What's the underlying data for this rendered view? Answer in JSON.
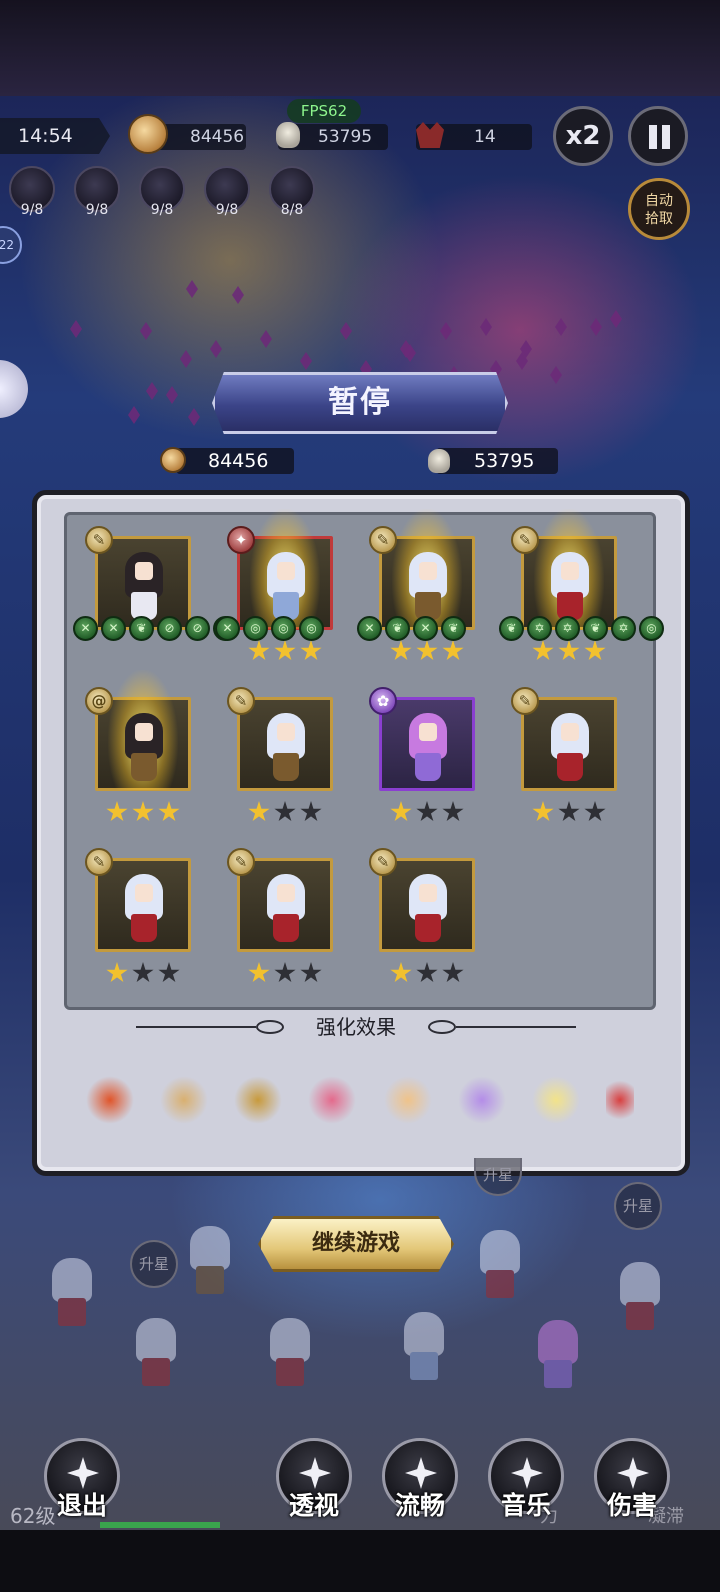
{
  "hud": {
    "fps": "FPS62",
    "timer": "14:54",
    "coins": "84456",
    "kills": "53795",
    "wave": "14",
    "speed_label": "x2",
    "pause_icon": "pause-icon",
    "auto_pickup_line1": "自动",
    "auto_pickup_line2": "拾取",
    "side_badge": "22",
    "skills": [
      {
        "icon": "key-icon",
        "level": "9/8"
      },
      {
        "icon": "sword-icon",
        "level": "9/8"
      },
      {
        "icon": "swirl-icon",
        "level": "9/8"
      },
      {
        "icon": "gear-star-icon",
        "level": "9/8"
      },
      {
        "icon": "claw-icon",
        "level": "8/8"
      }
    ]
  },
  "pause_panel": {
    "title": "暂停",
    "coins": "84456",
    "kills": "53795",
    "section_title": "强化效果",
    "continue_label": "继续游戏",
    "heroes": [
      {
        "element": "wind",
        "frame": "gold",
        "hair": "dark",
        "body": "white",
        "glow": false,
        "stars": 0,
        "gear": [
          "✕",
          "✕",
          "❦",
          "⊘",
          "⊘",
          "❦"
        ]
      },
      {
        "element": "fire",
        "frame": "red",
        "hair": "light",
        "body": "blue",
        "glow": true,
        "stars": 3,
        "gear": [
          "✕",
          "◎",
          "◎",
          "◎"
        ]
      },
      {
        "element": "wind",
        "frame": "gold",
        "hair": "light",
        "body": "gold",
        "glow": true,
        "stars": 3,
        "gear": [
          "✕",
          "❦",
          "✕",
          "❦"
        ]
      },
      {
        "element": "wind",
        "frame": "gold",
        "hair": "light",
        "body": "red",
        "glow": true,
        "stars": 3,
        "gear": [
          "❦",
          "✡",
          "✡",
          "❦",
          "✡",
          "◎"
        ]
      },
      {
        "element": "swirl",
        "frame": "gold",
        "hair": "dark",
        "body": "gold",
        "glow": true,
        "stars": 3,
        "gear": []
      },
      {
        "element": "wind",
        "frame": "gold",
        "hair": "light",
        "body": "gold",
        "glow": false,
        "stars": 1,
        "gear": []
      },
      {
        "element": "gear",
        "frame": "purple",
        "hair": "pink",
        "body": "violet",
        "glow": false,
        "stars": 1,
        "gear": []
      },
      {
        "element": "wind",
        "frame": "gold",
        "hair": "light",
        "body": "red",
        "glow": false,
        "stars": 1,
        "gear": []
      },
      {
        "element": "wind",
        "frame": "gold",
        "hair": "light",
        "body": "red",
        "glow": false,
        "stars": 1,
        "gear": []
      },
      {
        "element": "wind",
        "frame": "gold",
        "hair": "light",
        "body": "red",
        "glow": false,
        "stars": 1,
        "gear": []
      },
      {
        "element": "wind",
        "frame": "gold",
        "hair": "light",
        "body": "red",
        "glow": false,
        "stars": 1,
        "gear": []
      }
    ],
    "effects": [
      {
        "icon": "flame-spear-icon",
        "color": "#e0552a"
      },
      {
        "icon": "hourglass-icon",
        "color": "#d9b070"
      },
      {
        "icon": "spellbook-icon",
        "color": "#c89a3c"
      },
      {
        "icon": "mushroom-burst-icon",
        "color": "#e46a8c"
      },
      {
        "icon": "muscle-aura-icon",
        "color": "#efc38a"
      },
      {
        "icon": "crystal-tower-icon",
        "color": "#b48de8"
      },
      {
        "icon": "crescent-slash-icon",
        "color": "#f2e38a"
      },
      {
        "icon": "scroll-icon",
        "color": "#d84040"
      }
    ]
  },
  "field": {
    "upgrade_labels": [
      "升星",
      "升星",
      "升星"
    ]
  },
  "bottom_menu": {
    "level": "62级",
    "buttons": [
      {
        "label": "退出",
        "icon": "castle-icon"
      },
      {
        "label": "透视",
        "icon": "vortex-icon"
      },
      {
        "label": "流畅",
        "icon": "sparkle-icon"
      },
      {
        "label": "音乐",
        "icon": "speaker-icon"
      },
      {
        "label": "伤害",
        "icon": "bar-chart-icon"
      }
    ],
    "dim_right_1": "力",
    "dim_right_2": "凝滞"
  },
  "colors": {
    "panel_bg": "#cfd0dc",
    "gold_frame": "#c39a3e",
    "star_on": "#f2c12e",
    "fps_green": "#8df58d"
  }
}
